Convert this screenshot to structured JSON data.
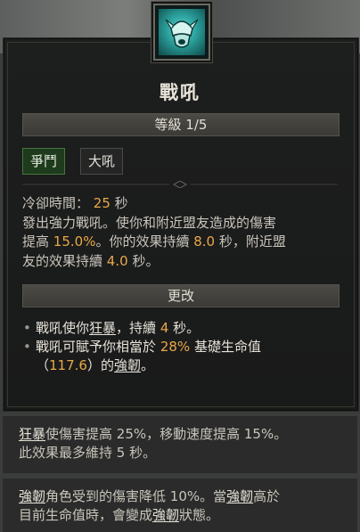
{
  "skill": {
    "icon": "viking-helmet-shout-icon",
    "name": "戰吼",
    "rank_label": "等級 1/5",
    "tags": [
      "爭鬥",
      "大吼"
    ]
  },
  "description": {
    "cooldown_label": "冷卻時間：",
    "cooldown_value": "25",
    "cooldown_unit": "秒",
    "line1": "發出強力戰吼。使你和附近盟友造成的傷害",
    "line2a": "提高",
    "dmg_pct": "15.0%",
    "line2b": "。你的效果持續",
    "self_duration": "8.0",
    "line2c": "秒，附近盟",
    "line3a": "友的效果持續",
    "ally_duration": "4.0",
    "line3b": "秒。"
  },
  "modifiers": {
    "header": "更改",
    "m1_a": "戰吼",
    "m1_b": "使你",
    "m1_link": "狂暴",
    "m1_c": "，持續",
    "m1_dur": "4",
    "m1_d": "秒。",
    "m2_a": "戰吼",
    "m2_b": "可賦予你相當於",
    "m2_pct": "28%",
    "m2_c": "基礎生命值",
    "m2_open": "（",
    "m2_val": "117.6",
    "m2_close": "）",
    "m2_d": "的",
    "m2_link": "強韌",
    "m2_e": "。"
  },
  "glossary": [
    {
      "term": "狂暴",
      "line1": "使傷害提高 25%，移動速度提高 15%。",
      "line2": "此效果最多維持 5 秒。"
    },
    {
      "term": "強韌",
      "line1a": "角色受到的傷害降低 10%。當",
      "term2": "強韌",
      "line1b": "高於",
      "line2a": "目前生命值時，會變成",
      "term3": "強韌",
      "line2b": "狀態。"
    }
  ],
  "colors": {
    "highlight": "#e8a84a",
    "tag_green": "#1e3b1d"
  }
}
